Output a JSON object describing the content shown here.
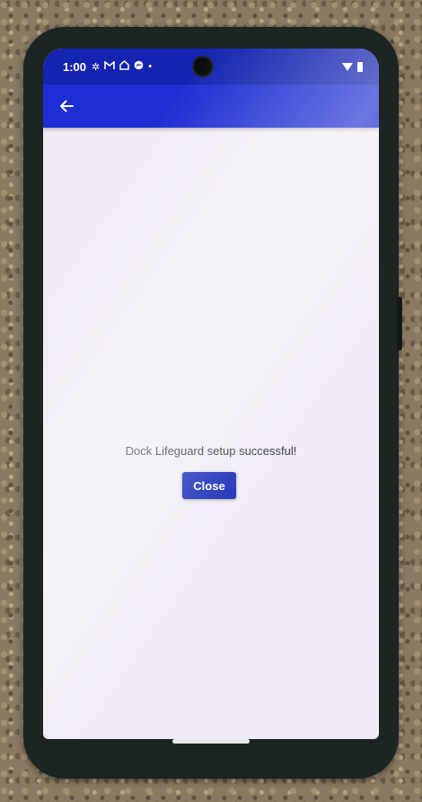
{
  "status_bar": {
    "time": "1:00",
    "notification_icons": [
      "pinwheel-icon",
      "gmail-icon",
      "home-icon",
      "messenger-icon",
      "dot-icon"
    ]
  },
  "app_bar": {
    "back_icon": "arrow-left-icon"
  },
  "dialog": {
    "message": "Dock Lifeguard setup successful!",
    "close_label": "Close"
  },
  "colors": {
    "status_bar": "#1424b0",
    "app_bar": "#1e2ed2",
    "button": "#1b2eb8",
    "background": "#f1ecf6"
  }
}
